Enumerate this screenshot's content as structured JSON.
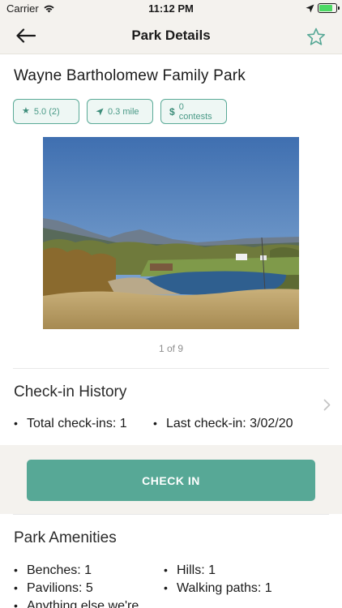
{
  "status_bar": {
    "carrier": "Carrier",
    "time": "11:12 PM"
  },
  "nav": {
    "title": "Park Details",
    "back_icon": "arrow-left-icon",
    "favorite_icon": "star-outline-icon"
  },
  "park": {
    "name": "Wayne Bartholomew Family Park"
  },
  "chips": {
    "rating": "5.0 (2)",
    "distance": "0.3 mile",
    "contests": "0 contests"
  },
  "photo": {
    "pager": "1 of 9"
  },
  "checkin_history": {
    "title": "Check-in History",
    "total": "Total check-ins: 1",
    "last": "Last check-in: 3/02/20"
  },
  "check_in_button": {
    "label": "CHECK IN"
  },
  "amenities": {
    "title": "Park Amenities",
    "items": [
      "Benches: 1",
      "Hills: 1",
      "Pavilions: 5",
      "Walking paths: 1",
      "Anything else we're"
    ]
  },
  "colors": {
    "accent": "#57a896",
    "header_bg": "#f4f2ee",
    "chip_bg": "#eef7f4"
  }
}
